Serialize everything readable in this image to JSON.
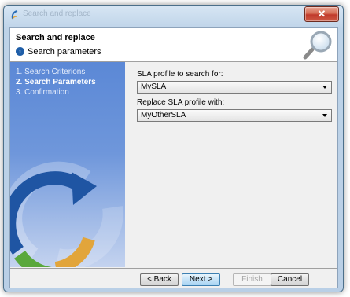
{
  "window": {
    "title": "Search and replace",
    "close_label": "✕"
  },
  "header": {
    "title": "Search and replace",
    "subtitle": "Search parameters",
    "info_glyph": "i"
  },
  "steps": [
    {
      "label": "1. Search Criterions",
      "active": false
    },
    {
      "label": "2. Search Parameters",
      "active": true
    },
    {
      "label": "3. Confirmation",
      "active": false
    }
  ],
  "form": {
    "search_label": "SLA profile to search for:",
    "search_value": "MySLA",
    "replace_label": "Replace SLA profile with:",
    "replace_value": "MyOtherSLA"
  },
  "buttons": {
    "back": "< Back",
    "next": "Next >",
    "finish": "Finish",
    "cancel": "Cancel"
  },
  "colors": {
    "side_panel": "#5b88d6",
    "swirl_blue": "#1f55a3",
    "swirl_green": "#5aa83c",
    "swirl_orange": "#e2a53b",
    "close_red": "#c0392b"
  }
}
